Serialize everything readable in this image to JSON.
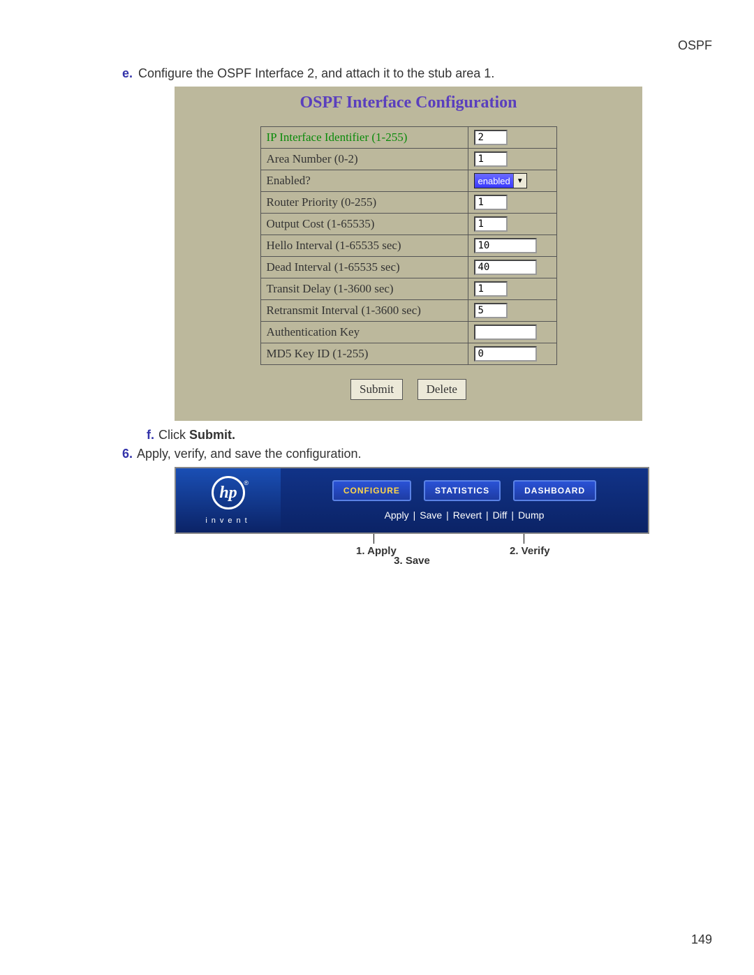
{
  "header": {
    "section": "OSPF"
  },
  "page_number": "149",
  "step_e": {
    "marker": "e.",
    "text": "Configure the OSPF Interface 2, and attach it to the stub area 1."
  },
  "config_panel": {
    "title": "OSPF Interface Configuration",
    "rows": [
      {
        "label": "IP Interface Identifier  (1-255)",
        "value": "2",
        "green": true,
        "short": true
      },
      {
        "label": "Area Number (0-2)",
        "value": "1",
        "short": true
      },
      {
        "label": "Enabled?",
        "value": "enabled",
        "type": "select"
      },
      {
        "label": "Router Priority (0-255)",
        "value": "1",
        "short": true
      },
      {
        "label": "Output Cost (1-65535)",
        "value": "1",
        "short": true
      },
      {
        "label": "Hello Interval (1-65535 sec)",
        "value": "10"
      },
      {
        "label": "Dead Interval (1-65535 sec)",
        "value": "40"
      },
      {
        "label": "Transit Delay (1-3600 sec)",
        "value": "1",
        "short": true
      },
      {
        "label": "Retransmit Interval (1-3600 sec)",
        "value": "5",
        "short": true
      },
      {
        "label": "Authentication Key",
        "value": ""
      },
      {
        "label": "MD5 Key ID (1-255)",
        "value": "0"
      }
    ],
    "buttons": {
      "submit": "Submit",
      "delete": "Delete"
    }
  },
  "step_f": {
    "marker": "f.",
    "prefix": "Click ",
    "bold": "Submit."
  },
  "step_6": {
    "marker": "6.",
    "text": "Apply, verify, and save the configuration."
  },
  "toolbar": {
    "logo_text": "hp",
    "invent": "invent",
    "tabs": {
      "configure": "CONFIGURE",
      "statistics": "STATISTICS",
      "dashboard": "DASHBOARD"
    },
    "links": [
      "Apply",
      "Save",
      "Revert",
      "Diff",
      "Dump"
    ],
    "annotations": {
      "apply": "1. Apply",
      "verify": "2. Verify",
      "save": "3. Save"
    }
  }
}
